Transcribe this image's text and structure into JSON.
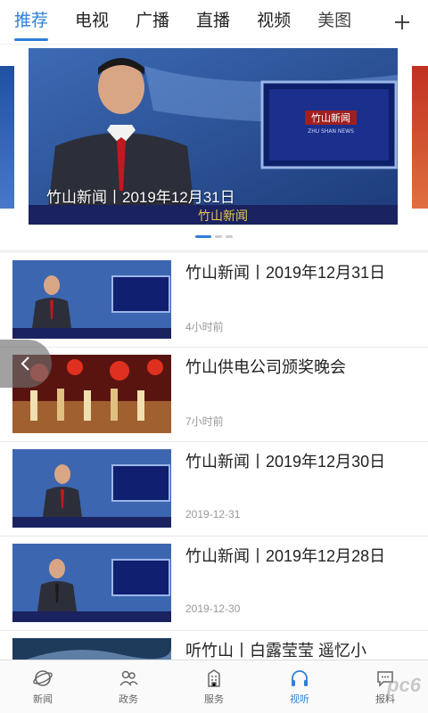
{
  "tabs": [
    {
      "label": "推荐",
      "active": true
    },
    {
      "label": "电视",
      "active": false
    },
    {
      "label": "广播",
      "active": false
    },
    {
      "label": "直播",
      "active": false
    },
    {
      "label": "视频",
      "active": false
    },
    {
      "label": "美图",
      "active": false
    }
  ],
  "banner": {
    "caption": "竹山新闻丨2019年12月31日",
    "studio_logo": "竹山新闻",
    "studio_logo_sub": "ZHU SHAN NEWS",
    "ticker": "竹山新闻",
    "slide_index": 1,
    "slide_count": 3
  },
  "news": [
    {
      "title": "竹山新闻丨2019年12月31日",
      "meta": "4小时前",
      "thumb": "news"
    },
    {
      "title": "竹山供电公司颁奖晚会",
      "meta": "7小时前",
      "thumb": "performance"
    },
    {
      "title": "竹山新闻丨2019年12月30日",
      "meta": "2019-12-31",
      "thumb": "news"
    },
    {
      "title": "竹山新闻丨2019年12月28日",
      "meta": "2019-12-30",
      "thumb": "news"
    },
    {
      "title": "听竹山丨白露莹莹 遥忆小",
      "meta": "",
      "thumb": "sky"
    }
  ],
  "bottom_nav": [
    {
      "label": "新闻",
      "icon": "planet-icon",
      "active": false
    },
    {
      "label": "政务",
      "icon": "people-icon",
      "active": false
    },
    {
      "label": "服务",
      "icon": "building-icon",
      "active": false
    },
    {
      "label": "视听",
      "icon": "headphones-icon",
      "active": true
    },
    {
      "label": "报料",
      "icon": "chat-icon",
      "active": false
    }
  ],
  "watermark": "pc6",
  "colors": {
    "accent": "#2f7fd8",
    "studio_blue": "#2a4d8f"
  }
}
